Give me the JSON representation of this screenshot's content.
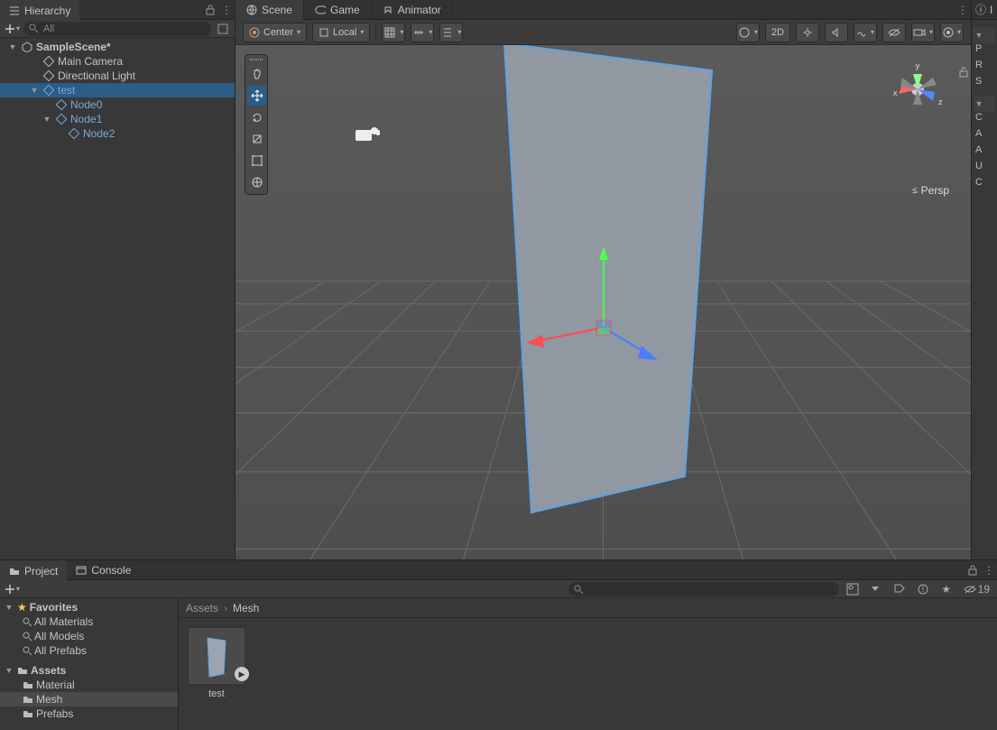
{
  "hierarchy": {
    "title": "Hierarchy",
    "search_placeholder": "All",
    "scene_name": "SampleScene*",
    "items": [
      {
        "label": "Main Camera",
        "depth": 1,
        "prefab": false
      },
      {
        "label": "Directional Light",
        "depth": 1,
        "prefab": false
      },
      {
        "label": "test",
        "depth": 1,
        "prefab": true,
        "selected": true,
        "expand": true
      },
      {
        "label": "Node0",
        "depth": 2,
        "prefab": true
      },
      {
        "label": "Node1",
        "depth": 2,
        "prefab": true,
        "expand": true
      },
      {
        "label": "Node2",
        "depth": 3,
        "prefab": true
      }
    ]
  },
  "scene": {
    "tabs": [
      {
        "label": "Scene",
        "active": true
      },
      {
        "label": "Game",
        "active": false
      },
      {
        "label": "Animator",
        "active": false
      }
    ],
    "pivot": "Center",
    "handle": "Local",
    "mode2d": "2D",
    "persp": "Persp"
  },
  "inspector": {
    "title": "I",
    "rows": [
      "P",
      "R",
      "S",
      "C",
      "A",
      "A",
      "U",
      "C"
    ]
  },
  "project": {
    "tabs": [
      {
        "label": "Project",
        "active": true
      },
      {
        "label": "Console",
        "active": false
      }
    ],
    "hidden_count": "19",
    "favorites_label": "Favorites",
    "favorites": [
      "All Materials",
      "All Models",
      "All Prefabs"
    ],
    "assets_label": "Assets",
    "folders": [
      {
        "label": "Material",
        "sel": false
      },
      {
        "label": "Mesh",
        "sel": true
      },
      {
        "label": "Prefabs",
        "sel": false
      }
    ],
    "breadcrumb": [
      "Assets",
      "Mesh"
    ],
    "grid": [
      {
        "label": "test"
      }
    ]
  }
}
